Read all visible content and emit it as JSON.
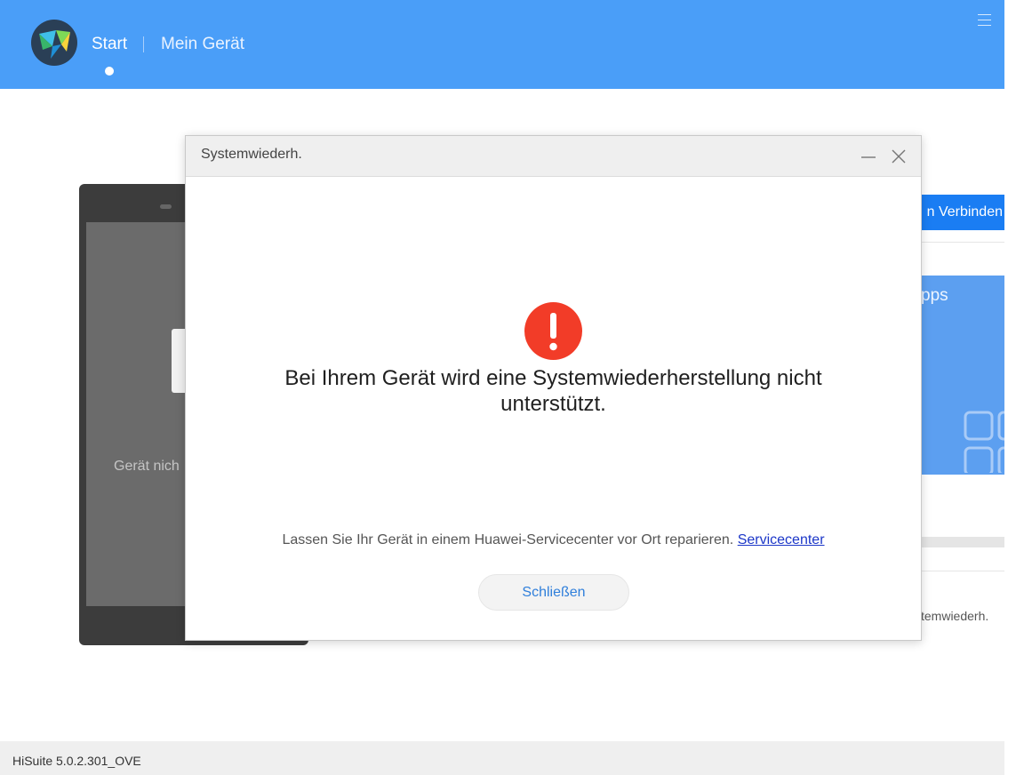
{
  "header": {
    "nav_start": "Start",
    "nav_my_device": "Mein Gerät",
    "accent_color": "#4a9ef8"
  },
  "background": {
    "connect_button_text": "n Verbinden",
    "apps_card_label": "pps",
    "phone_status_text": "Gerät nich",
    "side_label": "temwiederh."
  },
  "dialog": {
    "title": "Systemwiederh.",
    "message": "Bei Ihrem Gerät wird eine Systemwiederherstellung nicht unterstützt.",
    "hint_text": "Lassen Sie Ihr Gerät in einem Huawei-Servicecenter vor Ort reparieren.",
    "hint_link": "Servicecenter",
    "close_button": "Schließen",
    "alert_color": "#f23c28",
    "icons": [
      "minimize-icon",
      "close-icon",
      "alert-icon"
    ]
  },
  "footer": {
    "version": "HiSuite 5.0.2.301_OVE"
  }
}
